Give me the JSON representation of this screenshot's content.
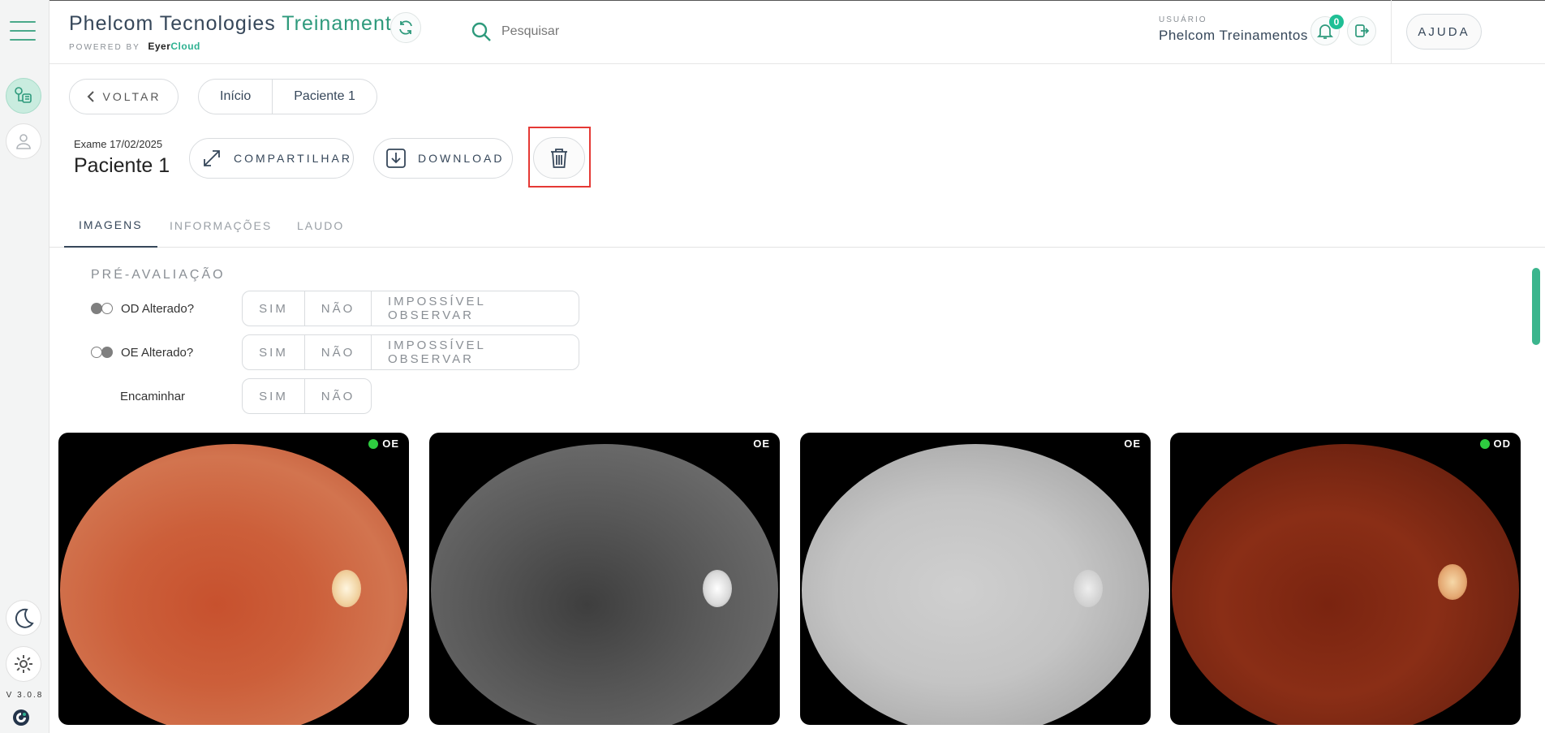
{
  "header": {
    "brand_title_main": "Phelcom Tecnologies",
    "brand_title_accent": "Treinamentos",
    "powered_by": "POWERED BY",
    "powered_brand_a": "Eyer",
    "powered_brand_b": "Cloud",
    "search_placeholder": "Pesquisar",
    "user_caption": "USUÁRIO",
    "user_name": "Phelcom Treinamentos",
    "notifications_count": "0",
    "help_label": "AJUDA"
  },
  "sidebar": {
    "version": "V 3.0.8"
  },
  "nav": {
    "back_label": "VOLTAR",
    "breadcrumb": [
      "Início",
      "Paciente 1"
    ]
  },
  "exam": {
    "date_label": "Exame 17/02/2025",
    "patient_name": "Paciente 1",
    "share_label": "COMPARTILHAR",
    "download_label": "DOWNLOAD"
  },
  "tabs": [
    "IMAGENS",
    "INFORMAÇÕES",
    "LAUDO"
  ],
  "pre_evaluation": {
    "title": "PRÉ-AVALIAÇÃO",
    "questions": [
      {
        "label": "OD Alterado?",
        "options": [
          "SIM",
          "NÃO",
          "IMPOSSÍVEL OBSERVAR"
        ]
      },
      {
        "label": "OE Alterado?",
        "options": [
          "SIM",
          "NÃO",
          "IMPOSSÍVEL OBSERVAR"
        ]
      },
      {
        "label": "Encaminhar",
        "options": [
          "SIM",
          "NÃO"
        ]
      }
    ]
  },
  "images": [
    {
      "eye": "OE",
      "status": "green"
    },
    {
      "eye": "OE",
      "status": "none"
    },
    {
      "eye": "OE",
      "status": "none"
    },
    {
      "eye": "OD",
      "status": "green"
    }
  ],
  "colors": {
    "accent": "#2e9a7c",
    "highlight": "#e53935",
    "status_green": "#2ecc40"
  }
}
